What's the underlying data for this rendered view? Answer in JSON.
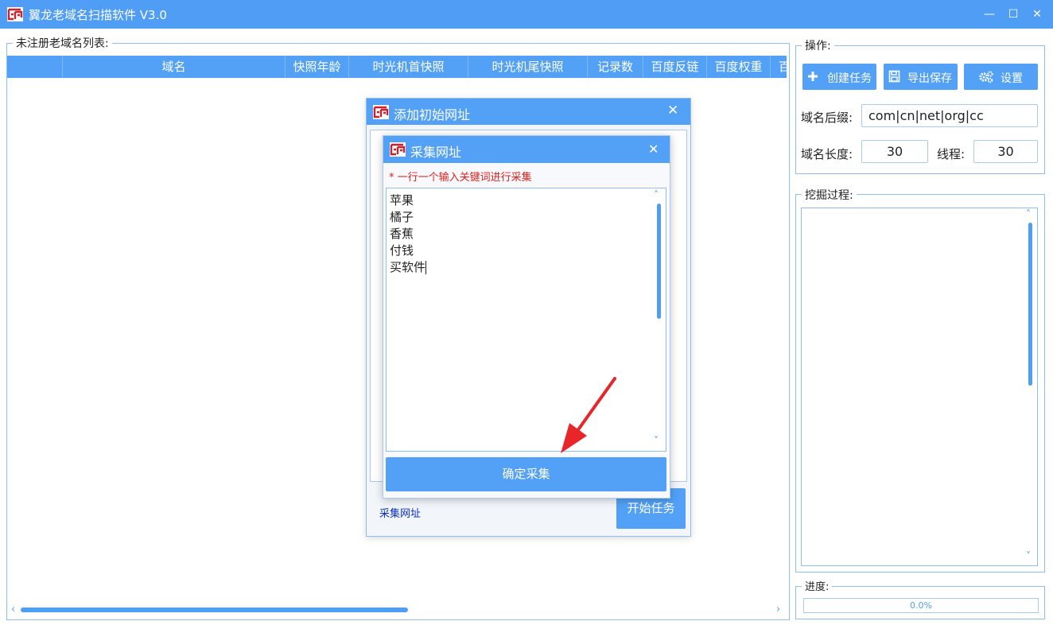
{
  "window": {
    "title": "翼龙老域名扫描软件 V3.0",
    "minimize": "—",
    "maximize": "☐",
    "close": "✕"
  },
  "colors": {
    "accent": "#4f9df5",
    "logo": "#d0202a",
    "hint": "#e0201a",
    "link": "#0a2fd2"
  },
  "domain_list": {
    "legend": "未注册老域名列表:",
    "columns": [
      "",
      "域名",
      "快照年龄",
      "时光机首快照",
      "时光机尾快照",
      "记录数",
      "百度反链",
      "百度权重",
      "百"
    ],
    "rows": []
  },
  "operations": {
    "legend": "操作:",
    "create_task": "创建任务",
    "export_save": "导出保存",
    "settings": "设置",
    "suffix_label": "域名后缀:",
    "suffix_value": "com|cn|net|org|cc",
    "length_label": "域名长度:",
    "length_value": "30",
    "threads_label": "线程:",
    "threads_value": "30"
  },
  "mining": {
    "legend": "挖掘过程:"
  },
  "progress": {
    "legend": "进度:",
    "value_text": "0.0%",
    "value": 0.0
  },
  "dialog_add_url": {
    "title": "添加初始网址",
    "collect_link": "采集网址",
    "start_button": "开始任务"
  },
  "dialog_collect": {
    "title": "采集网址",
    "hint": "* 一行一个输入关键词进行采集",
    "lines": [
      "苹果",
      "橘子",
      "香蕉",
      "付钱",
      "买软件"
    ],
    "confirm_button": "确定采集"
  }
}
